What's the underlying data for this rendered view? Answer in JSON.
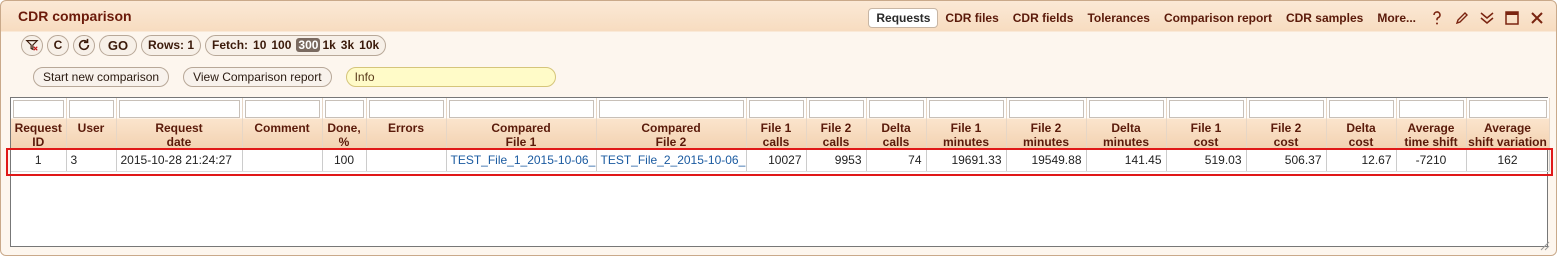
{
  "window": {
    "title": "CDR comparison"
  },
  "nav": {
    "tabs": [
      "Requests",
      "CDR files",
      "CDR fields",
      "Tolerances",
      "Comparison report",
      "CDR samples",
      "More..."
    ],
    "active": "Requests",
    "icons": [
      "help-icon",
      "edit-icon",
      "collapse-icon",
      "maximize-icon",
      "close-icon"
    ]
  },
  "toolbar": {
    "c_label": "C",
    "go_label": "GO",
    "rows_label": "Rows: 1",
    "fetch_label": "Fetch:",
    "fetch_options": [
      "10",
      "100",
      "300",
      "1k",
      "3k",
      "10k"
    ],
    "fetch_selected": "300"
  },
  "actions": {
    "start_label": "Start new comparison",
    "view_label": "View Comparison report",
    "info_value": "Info"
  },
  "table": {
    "columns": [
      {
        "l1": "Request",
        "l2": "ID"
      },
      {
        "l1": "User",
        "l2": ""
      },
      {
        "l1": "Request",
        "l2": "date"
      },
      {
        "l1": "Comment",
        "l2": ""
      },
      {
        "l1": "Done,",
        "l2": "%"
      },
      {
        "l1": "Errors",
        "l2": ""
      },
      {
        "l1": "Compared",
        "l2": "File 1"
      },
      {
        "l1": "Compared",
        "l2": "File 2"
      },
      {
        "l1": "File 1",
        "l2": "calls"
      },
      {
        "l1": "File 2",
        "l2": "calls"
      },
      {
        "l1": "Delta",
        "l2": "calls"
      },
      {
        "l1": "File 1",
        "l2": "minutes"
      },
      {
        "l1": "File 2",
        "l2": "minutes"
      },
      {
        "l1": "Delta",
        "l2": "minutes"
      },
      {
        "l1": "File 1",
        "l2": "cost"
      },
      {
        "l1": "File 2",
        "l2": "cost"
      },
      {
        "l1": "Delta",
        "l2": "cost"
      },
      {
        "l1": "Average",
        "l2": "time shift"
      },
      {
        "l1": "Average",
        "l2": "shift variation"
      }
    ],
    "rows": [
      [
        "1",
        "3",
        "2015-10-28 21:24:27",
        "",
        "100",
        "",
        "TEST_File_1_2015-10-06_",
        "TEST_File_2_2015-10-06_",
        "10027",
        "9953",
        "74",
        "19691.33",
        "19549.88",
        "141.45",
        "519.03",
        "506.37",
        "12.67",
        "-7210",
        "162"
      ]
    ]
  },
  "colors": {
    "accent": "#6b1a0a",
    "highlight_border": "#e01818",
    "link": "#1a5aa0"
  }
}
